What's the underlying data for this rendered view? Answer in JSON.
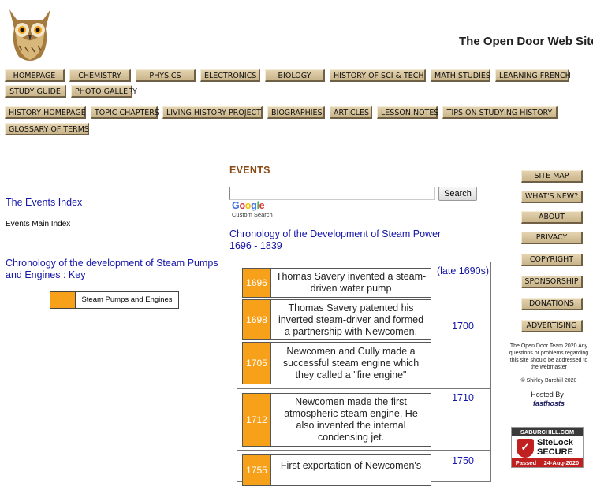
{
  "header": {
    "site_title": "The Open Door Web Site"
  },
  "nav_row1": [
    "HOMEPAGE",
    "CHEMISTRY",
    "PHYSICS",
    "ELECTRONICS",
    "BIOLOGY",
    "HISTORY OF SCI & TECH",
    "MATH STUDIES",
    "LEARNING FRENCH"
  ],
  "nav_row2": [
    "STUDY GUIDE",
    "PHOTO GALLERY"
  ],
  "nav_row3": [
    "HISTORY HOMEPAGE",
    "TOPIC CHAPTERS",
    "LIVING HISTORY PROJECT",
    "BIOGRAPHIES",
    "ARTICLES",
    "LESSON NOTES",
    "TIPS ON STUDYING HISTORY"
  ],
  "nav_row4": [
    "GLOSSARY OF TERMS"
  ],
  "main": {
    "heading": "EVENTS",
    "search_button": "Search",
    "google_logo": "Google",
    "custom_search": "Custom Search",
    "chronology_title": "Chronology of the Development of Steam Power",
    "chronology_years": "1696 - 1839"
  },
  "left": {
    "events_index": "The Events Index",
    "events_main_index": "Events Main Index",
    "key_title": "Chronology of the development of Steam Pumps and Engines : Key",
    "legend_label": "Steam Pumps and Engines",
    "legend_color": "#f7a11a"
  },
  "table": {
    "events": [
      {
        "year": "1696",
        "text": "Thomas Savery invented a steam-driven water pump"
      },
      {
        "year": "1698",
        "text": "Thomas Savery patented his inverted steam-driver and formed a partnership with Newcomen."
      },
      {
        "year": "1705",
        "text": "Newcomen and Cully made a successful steam engine which they called a \"fire engine\""
      },
      {
        "year": "1712",
        "text": "Newcomen made the first atmospheric steam engine. He also invented the internal condensing jet."
      },
      {
        "year": "1755",
        "text": "First exportation of Newcomen's"
      }
    ],
    "right_years": [
      "(late 1690s)",
      "1700",
      "1710",
      "1750"
    ]
  },
  "sidebar": {
    "buttons": [
      "SITE MAP",
      "WHAT'S NEW?",
      "ABOUT",
      "PRIVACY",
      "COPYRIGHT",
      "SPONSORSHIP",
      "DONATIONS",
      "ADVERTISING"
    ],
    "team_text": "The Open Door Team 2020 Any questions or problems regarding this site should be addressed to the webmaster",
    "copyright": "© Shirley Burchill 2020",
    "hosted_by": "Hosted By",
    "host_logo": "fasthosts",
    "sitelock_top": "SABURCHILL.COM",
    "sitelock_brand": "SiteLock",
    "sitelock_secure": "SECURE",
    "sitelock_passed": "Passed",
    "sitelock_date": "24-Aug-2020"
  }
}
